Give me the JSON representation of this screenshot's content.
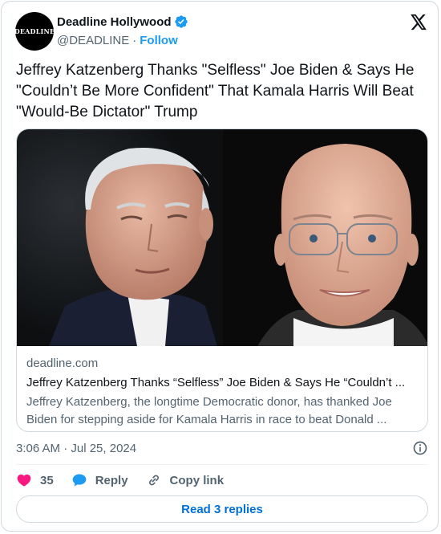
{
  "account": {
    "avatar_text": "DEADLINE",
    "display_name": "Deadline Hollywood",
    "handle": "@DEADLINE",
    "separator": "·",
    "follow_label": "Follow",
    "verified_color": "#1d9bf0"
  },
  "tweet": {
    "text": "Jeffrey Katzenberg Thanks \"Selfless\" Joe Biden & Says He \"Couldn’t Be More Confident\" That Kamala Harris Will Beat \"Would-Be Dictator\" Trump"
  },
  "link_card": {
    "domain": "deadline.com",
    "title": "Jeffrey Katzenberg Thanks “Selfless” Joe Biden & Says He “Couldn’t ...",
    "description": "Jeffrey Katzenberg, the longtime Democratic donor, has thanked Joe Biden for stepping aside for Kamala Harris in race to beat Donald ..."
  },
  "meta": {
    "timestamp": "3:06 AM · Jul 25, 2024"
  },
  "actions": {
    "like_count": "35",
    "reply_label": "Reply",
    "copy_link_label": "Copy link",
    "read_replies_label": "Read 3 replies"
  },
  "colors": {
    "accent": "#1d9bf0",
    "like": "#f91880",
    "link_button_text": "#006fd6"
  }
}
